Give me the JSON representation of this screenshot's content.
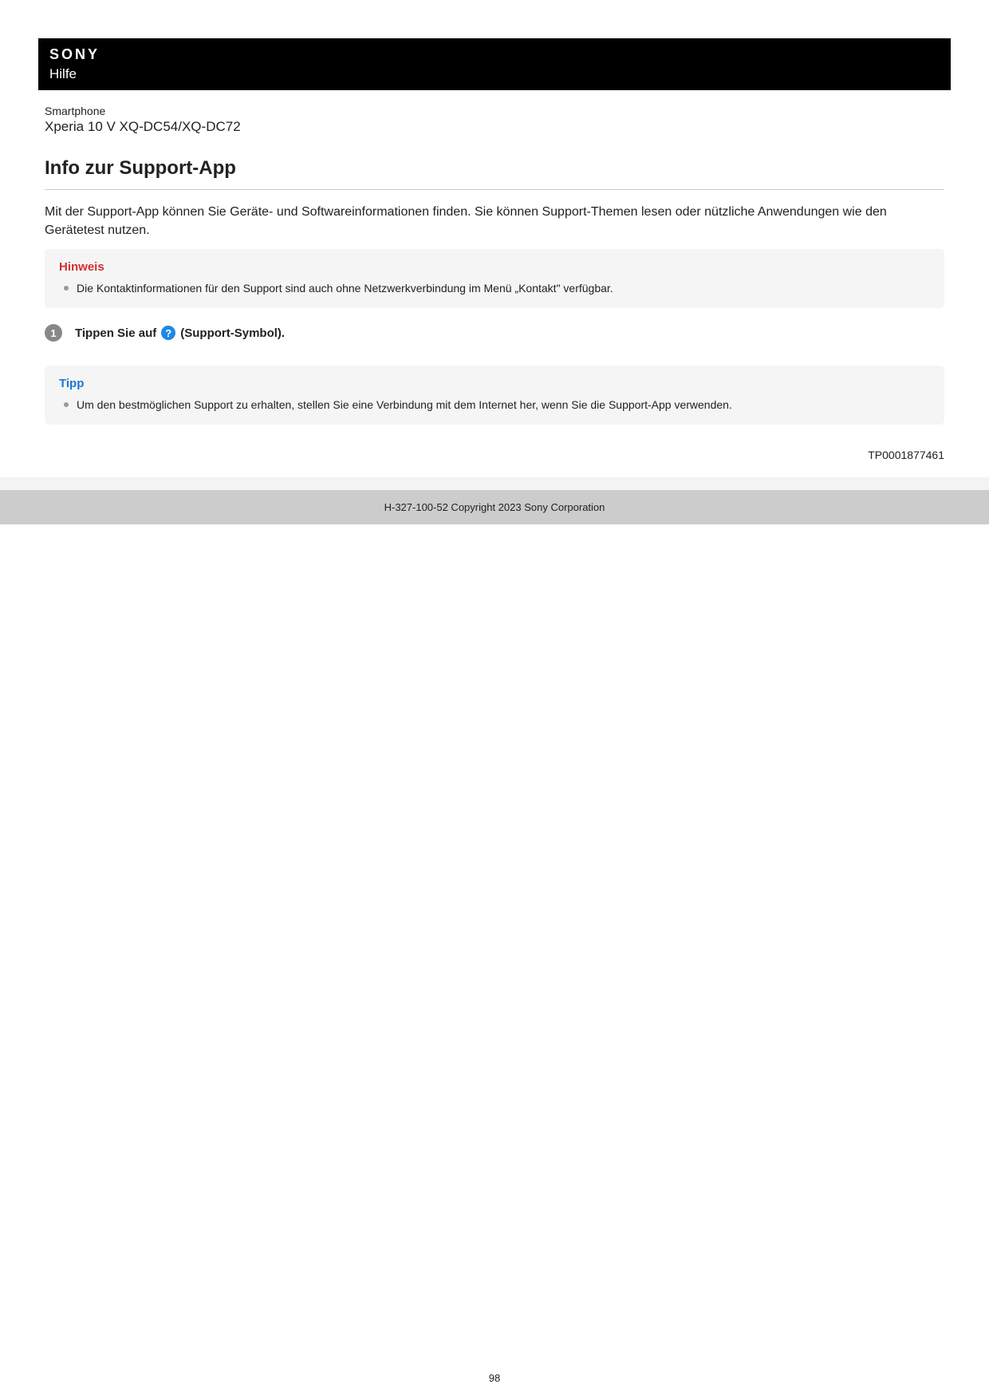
{
  "header": {
    "brand": "SONY",
    "help_label": "Hilfe"
  },
  "device": {
    "type": "Smartphone",
    "model": "Xperia 10 V XQ-DC54/XQ-DC72"
  },
  "page_title": "Info zur Support-App",
  "intro": "Mit der Support-App können Sie Geräte- und Softwareinformationen finden. Sie können Support-Themen lesen oder nützliche Anwendungen wie den Gerätetest nutzen.",
  "note": {
    "title": "Hinweis",
    "text": "Die Kontaktinformationen für den Support sind auch ohne Netzwerkverbindung im Menü „Kontakt\" verfügbar."
  },
  "step": {
    "number": "1",
    "text_before": "Tippen Sie auf",
    "icon_glyph": "?",
    "text_after": "(Support-Symbol)."
  },
  "tip": {
    "title": "Tipp",
    "text": "Um den bestmöglichen Support zu erhalten, stellen Sie eine Verbindung mit dem Internet her, wenn Sie die Support-App verwenden."
  },
  "tp_code": "TP0001877461",
  "footer": "H-327-100-52 Copyright 2023 Sony Corporation",
  "page_number": "98"
}
